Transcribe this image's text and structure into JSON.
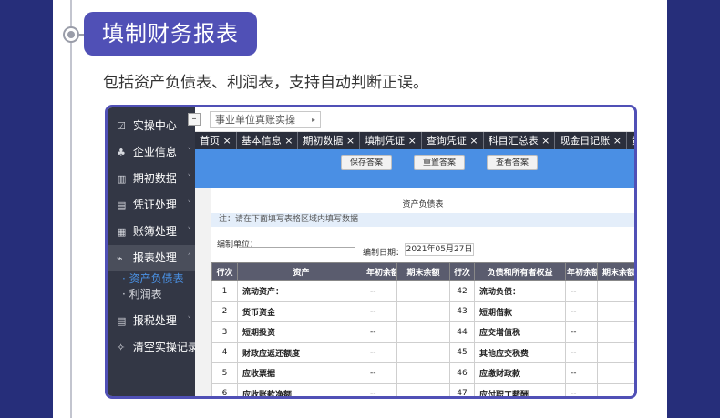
{
  "heading": {
    "title": "填制财务报表",
    "subtitle": "包括资产负债表、利润表，支持自动判断正误。"
  },
  "sidebar": {
    "items": [
      {
        "label": "实操中心",
        "icon": "clipboard-check-icon",
        "glyph": "☑",
        "caret": ""
      },
      {
        "label": "企业信息",
        "icon": "users-icon",
        "glyph": "♣",
        "caret": "˅"
      },
      {
        "label": "期初数据",
        "icon": "bar-chart-icon",
        "glyph": "▥",
        "caret": "˅"
      },
      {
        "label": "凭证处理",
        "icon": "document-icon",
        "glyph": "▤",
        "caret": "˅"
      },
      {
        "label": "账簿处理",
        "icon": "ledger-icon",
        "glyph": "▦",
        "caret": "˅"
      },
      {
        "label": "报表处理",
        "icon": "line-chart-icon",
        "glyph": "⌁",
        "caret": "˄"
      }
    ],
    "report_subitems": [
      "· 资产负债表",
      "· 利润表"
    ],
    "bottom_items": [
      {
        "label": "报税处理",
        "icon": "tax-icon",
        "glyph": "▤",
        "caret": "˅"
      },
      {
        "label": "清空实操记录",
        "icon": "broom-icon",
        "glyph": "✧",
        "caret": ""
      }
    ]
  },
  "topbar": {
    "collapse_glyph": "–",
    "unit_name": "事业单位真账实操",
    "arrow": "▸"
  },
  "tabs": [
    "首页 ×",
    "基本信息 ×",
    "期初数据 ×",
    "填制凭证 ×",
    "查询凭证 ×",
    "科目汇总表 ×",
    "现金日记账 ×",
    "资产"
  ],
  "toolbar": {
    "save": "保存答案",
    "reset": "重置答案",
    "view": "查看答案"
  },
  "sheet": {
    "title": "资产负债表",
    "note": "注：请在下面填写表格区域内填写数据",
    "unit_label": "编制单位：",
    "date_label": "编制日期：",
    "date_value": "2021年05月27日"
  },
  "table": {
    "headers": [
      "行次",
      "资产",
      "年初余额",
      "期末余额",
      "行次",
      "负债和所有者权益",
      "年初余额",
      "期末余额"
    ],
    "rows": [
      [
        "1",
        "流动资产：",
        "--",
        "",
        "42",
        "流动负债：",
        "--",
        ""
      ],
      [
        "2",
        "货币资金",
        "--",
        "",
        "43",
        "短期借款",
        "--",
        ""
      ],
      [
        "3",
        "短期投资",
        "--",
        "",
        "44",
        "应交增值税",
        "--",
        ""
      ],
      [
        "4",
        "财政应返还额度",
        "--",
        "",
        "45",
        "其他应交税费",
        "--",
        ""
      ],
      [
        "5",
        "应收票据",
        "--",
        "",
        "46",
        "应缴财政款",
        "--",
        ""
      ],
      [
        "6",
        "应收账款净额",
        "--",
        "",
        "47",
        "应付职工薪酬",
        "--",
        ""
      ]
    ]
  },
  "colors": {
    "brand": "#5050b6",
    "band": "#262e7a",
    "toolbar_blue": "#4a8fe4",
    "sidebar_bg": "#333745"
  }
}
